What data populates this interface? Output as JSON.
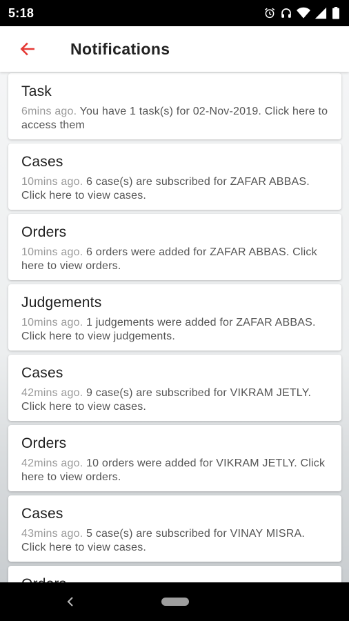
{
  "status_bar": {
    "time": "5:18",
    "icons": [
      "alarm-icon",
      "headset-icon",
      "wifi-icon",
      "signal-icon",
      "battery-icon"
    ]
  },
  "header": {
    "title": "Notifications",
    "back_icon": "arrow-left-icon",
    "accent_color": "#e53935"
  },
  "notifications": [
    {
      "title": "Task",
      "time": "6mins ago.",
      "message": " You have 1 task(s) for 02-Nov-2019. Click here to access them"
    },
    {
      "title": "Cases",
      "time": "10mins ago.",
      "message": " 6 case(s) are subscribed for ZAFAR ABBAS. Click here to view cases."
    },
    {
      "title": "Orders",
      "time": "10mins ago.",
      "message": " 6 orders were added for ZAFAR ABBAS. Click here to view orders."
    },
    {
      "title": "Judgements",
      "time": "10mins ago.",
      "message": " 1 judgements were added for ZAFAR ABBAS. Click here to view judgements."
    },
    {
      "title": "Cases",
      "time": "42mins ago.",
      "message": " 9 case(s) are subscribed for VIKRAM JETLY. Click here to view cases."
    },
    {
      "title": "Orders",
      "time": "42mins ago.",
      "message": " 10 orders were added for VIKRAM JETLY. Click here to view orders."
    },
    {
      "title": "Cases",
      "time": "43mins ago.",
      "message": " 5 case(s) are subscribed for VINAY MISRA. Click here to view cases."
    },
    {
      "title": "Orders",
      "time": "",
      "message": ""
    }
  ],
  "nav_bar": {
    "back_icon": "nav-back-icon",
    "home_icon": "home-pill-icon"
  }
}
